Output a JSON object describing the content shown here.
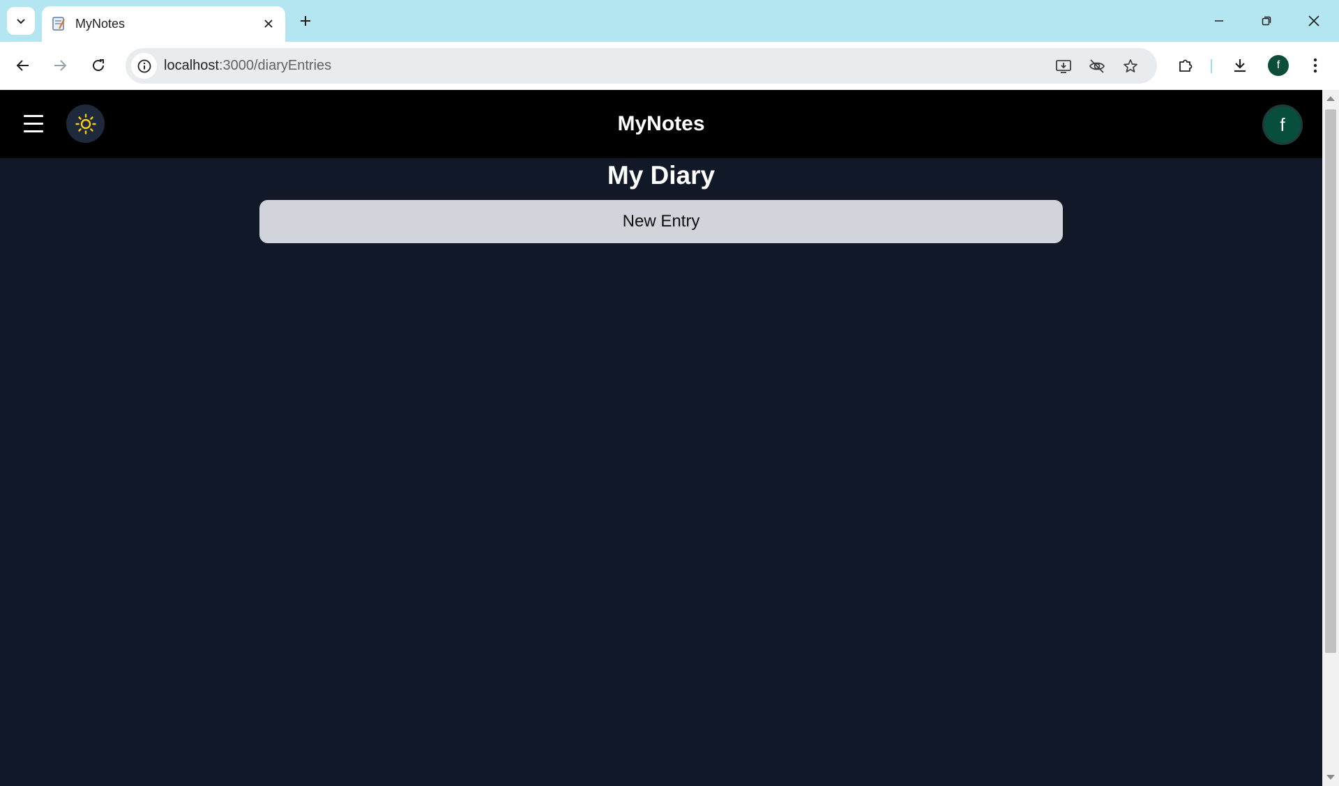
{
  "browser": {
    "tab_title": "MyNotes",
    "url_host": "localhost",
    "url_path": ":3000/diaryEntries",
    "profile_initial": "f"
  },
  "app": {
    "title": "MyNotes",
    "avatar_initial": "f",
    "theme_icon": "sun-icon",
    "accent_color": "#facc15",
    "background_color": "#111827",
    "header_color": "#000000"
  },
  "page": {
    "heading": "My Diary",
    "new_entry_label": "New Entry"
  }
}
